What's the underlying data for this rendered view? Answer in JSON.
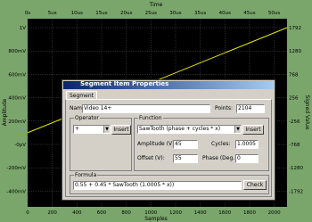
{
  "chart_data": {
    "type": "line",
    "title": "Time",
    "xlabel": "Samples",
    "ylabel": "Amplitude",
    "y2label": "Signed Value",
    "top_ticks": [
      "0s",
      "5us",
      "10us",
      "15us",
      "20us",
      "25us",
      "30us",
      "35us",
      "40us",
      "45us",
      "50us"
    ],
    "x_ticks": [
      "0",
      "200",
      "400",
      "600",
      "800",
      "1000",
      "1200",
      "1400",
      "1600",
      "1800",
      "2000"
    ],
    "y_ticks": [
      "1V",
      "800mV",
      "600mV",
      "400mV",
      "200mV",
      "-0pV",
      "-200mV",
      "-400mV"
    ],
    "y2_ticks": [
      "1792",
      "1280",
      "768",
      "256",
      "-256",
      "-768",
      "-1280",
      "-1792"
    ],
    "xlim": [
      0,
      2104
    ],
    "series": [
      {
        "x": [
          0,
          2104
        ],
        "y": [
          0.1,
          1.0
        ]
      }
    ],
    "colors": {
      "line": "#e8e800",
      "background": "#000000",
      "frame": "#7aa66b"
    }
  },
  "dialog": {
    "title": "Segment Item Properties",
    "tab": "Segment",
    "name_label": "Name:",
    "name_value": "Video 14+",
    "points_label": "Points:",
    "points_value": "2104",
    "operator_group": "Operator",
    "operator_value": "+",
    "operator_insert": "Insert",
    "function_group": "Function",
    "function_value": "SawTooth (phase + cycles * x)",
    "function_insert": "Insert",
    "amplitude_label": "Amplitude (V):",
    "amplitude_value": "45",
    "cycles_label": "Cycles:",
    "cycles_value": "1.0005",
    "offset_label": "Offset (V):",
    "offset_value": "55",
    "phase_label": "Phase (Deg.):",
    "phase_value": "0",
    "formula_group": "Formula",
    "formula_value": "0.55 + 0.45 * SawTooth (1.0005 * x))",
    "check_label": "Check"
  }
}
